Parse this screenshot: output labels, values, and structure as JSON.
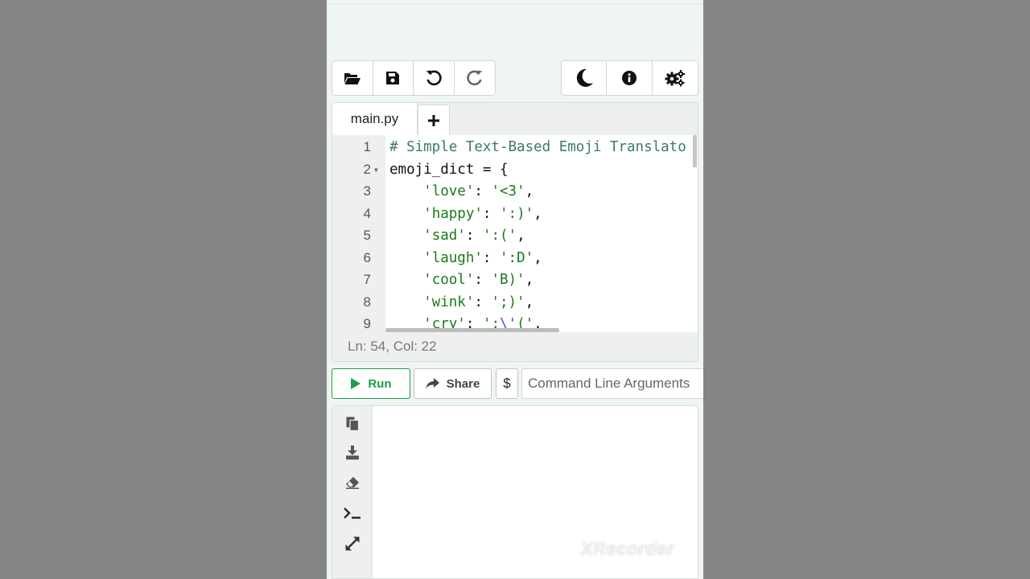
{
  "toolbar": {
    "left_buttons": [
      {
        "icon": "folder-open-icon"
      },
      {
        "icon": "save-icon"
      },
      {
        "icon": "undo-icon"
      },
      {
        "icon": "redo-icon"
      }
    ],
    "right_buttons": [
      {
        "icon": "moon-icon"
      },
      {
        "icon": "info-icon"
      },
      {
        "icon": "gears-icon"
      }
    ]
  },
  "editor": {
    "tab_label": "main.py",
    "add_tab_label": "+",
    "lines": [
      {
        "n": "1",
        "text": "# Simple Text-Based Emoji Translato"
      },
      {
        "n": "2",
        "text": "emoji_dict = {"
      },
      {
        "n": "3",
        "text": "'love': '<3',"
      },
      {
        "n": "4",
        "text": "'happy': ':)',"
      },
      {
        "n": "5",
        "text": "'sad': ':(',"
      },
      {
        "n": "6",
        "text": "'laugh': ':D',"
      },
      {
        "n": "7",
        "text": "'cool': 'B)',"
      },
      {
        "n": "8",
        "text": "'wink': ';)',"
      },
      {
        "n": "9",
        "text": "'cry': ':\\'(',"
      }
    ],
    "status": "Ln: 54,  Col: 22"
  },
  "run_bar": {
    "run_label": "Run",
    "share_label": "Share",
    "dollar_label": "$",
    "args_placeholder": "Command Line Arguments"
  },
  "output_panel": {
    "buttons": [
      {
        "icon": "copy-icon"
      },
      {
        "icon": "download-icon"
      },
      {
        "icon": "eraser-icon"
      },
      {
        "icon": "terminal-icon"
      },
      {
        "icon": "expand-icon"
      }
    ]
  },
  "watermark": "XRecorder",
  "colors": {
    "accent_green": "#1e9e4a",
    "comment": "#3a7d5d",
    "string": "#1a7a1a",
    "escape": "#3b4fd6"
  }
}
